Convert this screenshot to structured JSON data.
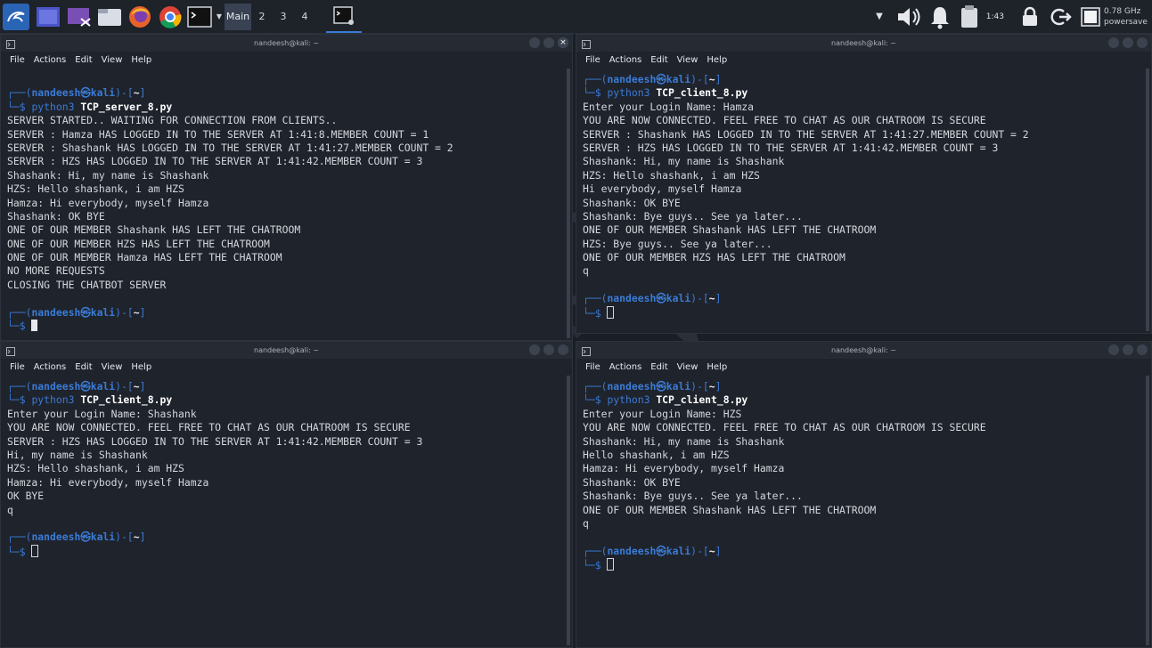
{
  "panel": {
    "workspaces": [
      "Main",
      "2",
      "3",
      "4"
    ],
    "clock": "1:43",
    "cpu_freq": "0.78 GHz",
    "cpu_governor": "powersave"
  },
  "windows": [
    {
      "id": "server",
      "title": "nandeesh@kali: ~",
      "menu": [
        "File",
        "Actions",
        "Edit",
        "View",
        "Help"
      ],
      "lines": [
        {
          "kind": "blank"
        },
        {
          "kind": "prompt-top",
          "user": "nandeesh",
          "host": "kali",
          "dir": "~"
        },
        {
          "kind": "prompt-cmd",
          "cmd": "python3",
          "arg": "TCP_server_8.py"
        },
        {
          "kind": "text",
          "text": "SERVER STARTED.. WAITING FOR CONNECTION FROM CLIENTS.."
        },
        {
          "kind": "text",
          "text": "SERVER : Hamza HAS LOGGED IN TO THE SERVER AT 1:41:8.MEMBER COUNT = 1"
        },
        {
          "kind": "text",
          "text": "SERVER : Shashank HAS LOGGED IN TO THE SERVER AT 1:41:27.MEMBER COUNT = 2"
        },
        {
          "kind": "text",
          "text": "SERVER : HZS HAS LOGGED IN TO THE SERVER AT 1:41:42.MEMBER COUNT = 3"
        },
        {
          "kind": "text",
          "text": "Shashank: Hi, my name is Shashank"
        },
        {
          "kind": "text",
          "text": "HZS: Hello shashank, i am HZS"
        },
        {
          "kind": "text",
          "text": "Hamza: Hi everybody, myself Hamza"
        },
        {
          "kind": "text",
          "text": "Shashank: OK BYE"
        },
        {
          "kind": "text",
          "text": "ONE OF OUR MEMBER Shashank HAS LEFT THE CHATROOM"
        },
        {
          "kind": "text",
          "text": "ONE OF OUR MEMBER HZS HAS LEFT THE CHATROOM"
        },
        {
          "kind": "text",
          "text": "ONE OF OUR MEMBER Hamza HAS LEFT THE CHATROOM"
        },
        {
          "kind": "text",
          "text": "NO MORE REQUESTS"
        },
        {
          "kind": "text",
          "text": "CLOSING THE CHATBOT SERVER"
        },
        {
          "kind": "blank"
        },
        {
          "kind": "prompt-top",
          "user": "nandeesh",
          "host": "kali",
          "dir": "~"
        },
        {
          "kind": "prompt-cursor",
          "cursor": "block"
        }
      ]
    },
    {
      "id": "client-hamza",
      "title": "nandeesh@kali: ~",
      "menu": [
        "File",
        "Actions",
        "Edit",
        "View",
        "Help"
      ],
      "lines": [
        {
          "kind": "prompt-top",
          "user": "nandeesh",
          "host": "kali",
          "dir": "~"
        },
        {
          "kind": "prompt-cmd",
          "cmd": "python3",
          "arg": "TCP_client_8.py"
        },
        {
          "kind": "text",
          "text": "Enter your Login Name: Hamza"
        },
        {
          "kind": "text",
          "text": "YOU ARE NOW CONNECTED. FEEL FREE TO CHAT AS OUR CHATROOM IS SECURE"
        },
        {
          "kind": "text",
          "text": "SERVER : Shashank HAS LOGGED IN TO THE SERVER AT 1:41:27.MEMBER COUNT = 2"
        },
        {
          "kind": "text",
          "text": "SERVER : HZS HAS LOGGED IN TO THE SERVER AT 1:41:42.MEMBER COUNT = 3"
        },
        {
          "kind": "text",
          "text": "Shashank: Hi, my name is Shashank"
        },
        {
          "kind": "text",
          "text": "HZS: Hello shashank, i am HZS"
        },
        {
          "kind": "text",
          "text": "Hi everybody, myself Hamza"
        },
        {
          "kind": "text",
          "text": "Shashank: OK BYE"
        },
        {
          "kind": "text",
          "text": "Shashank: Bye guys.. See ya later..."
        },
        {
          "kind": "text",
          "text": "ONE OF OUR MEMBER Shashank HAS LEFT THE CHATROOM"
        },
        {
          "kind": "text",
          "text": "HZS: Bye guys.. See ya later..."
        },
        {
          "kind": "text",
          "text": "ONE OF OUR MEMBER HZS HAS LEFT THE CHATROOM"
        },
        {
          "kind": "text",
          "text": "q"
        },
        {
          "kind": "blank"
        },
        {
          "kind": "prompt-top",
          "user": "nandeesh",
          "host": "kali",
          "dir": "~"
        },
        {
          "kind": "prompt-cursor",
          "cursor": "box"
        }
      ]
    },
    {
      "id": "client-shashank",
      "title": "nandeesh@kali: ~",
      "menu": [
        "File",
        "Actions",
        "Edit",
        "View",
        "Help"
      ],
      "lines": [
        {
          "kind": "prompt-top",
          "user": "nandeesh",
          "host": "kali",
          "dir": "~"
        },
        {
          "kind": "prompt-cmd",
          "cmd": "python3",
          "arg": "TCP_client_8.py"
        },
        {
          "kind": "text",
          "text": "Enter your Login Name: Shashank"
        },
        {
          "kind": "text",
          "text": "YOU ARE NOW CONNECTED. FEEL FREE TO CHAT AS OUR CHATROOM IS SECURE"
        },
        {
          "kind": "text",
          "text": "SERVER : HZS HAS LOGGED IN TO THE SERVER AT 1:41:42.MEMBER COUNT = 3"
        },
        {
          "kind": "text",
          "text": "Hi, my name is Shashank"
        },
        {
          "kind": "text",
          "text": "HZS: Hello shashank, i am HZS"
        },
        {
          "kind": "text",
          "text": "Hamza: Hi everybody, myself Hamza"
        },
        {
          "kind": "text",
          "text": "OK BYE"
        },
        {
          "kind": "text",
          "text": "q"
        },
        {
          "kind": "blank"
        },
        {
          "kind": "prompt-top",
          "user": "nandeesh",
          "host": "kali",
          "dir": "~"
        },
        {
          "kind": "prompt-cursor",
          "cursor": "box"
        }
      ]
    },
    {
      "id": "client-hzs",
      "title": "nandeesh@kali: ~",
      "menu": [
        "File",
        "Actions",
        "Edit",
        "View",
        "Help"
      ],
      "lines": [
        {
          "kind": "prompt-top",
          "user": "nandeesh",
          "host": "kali",
          "dir": "~"
        },
        {
          "kind": "prompt-cmd",
          "cmd": "python3",
          "arg": "TCP_client_8.py"
        },
        {
          "kind": "text",
          "text": "Enter your Login Name: HZS"
        },
        {
          "kind": "text",
          "text": "YOU ARE NOW CONNECTED. FEEL FREE TO CHAT AS OUR CHATROOM IS SECURE"
        },
        {
          "kind": "text",
          "text": "Shashank: Hi, my name is Shashank"
        },
        {
          "kind": "text",
          "text": "Hello shashank, i am HZS"
        },
        {
          "kind": "text",
          "text": "Hamza: Hi everybody, myself Hamza"
        },
        {
          "kind": "text",
          "text": "Shashank: OK BYE"
        },
        {
          "kind": "text",
          "text": "Shashank: Bye guys.. See ya later..."
        },
        {
          "kind": "text",
          "text": "ONE OF OUR MEMBER Shashank HAS LEFT THE CHATROOM"
        },
        {
          "kind": "text",
          "text": "q"
        },
        {
          "kind": "blank"
        },
        {
          "kind": "prompt-top",
          "user": "nandeesh",
          "host": "kali",
          "dir": "~"
        },
        {
          "kind": "prompt-cursor",
          "cursor": "box"
        }
      ]
    }
  ],
  "colors": {
    "prompt": "#3a7bd5",
    "text": "#d4d7dc",
    "terminal_bg": "#1f232c"
  }
}
